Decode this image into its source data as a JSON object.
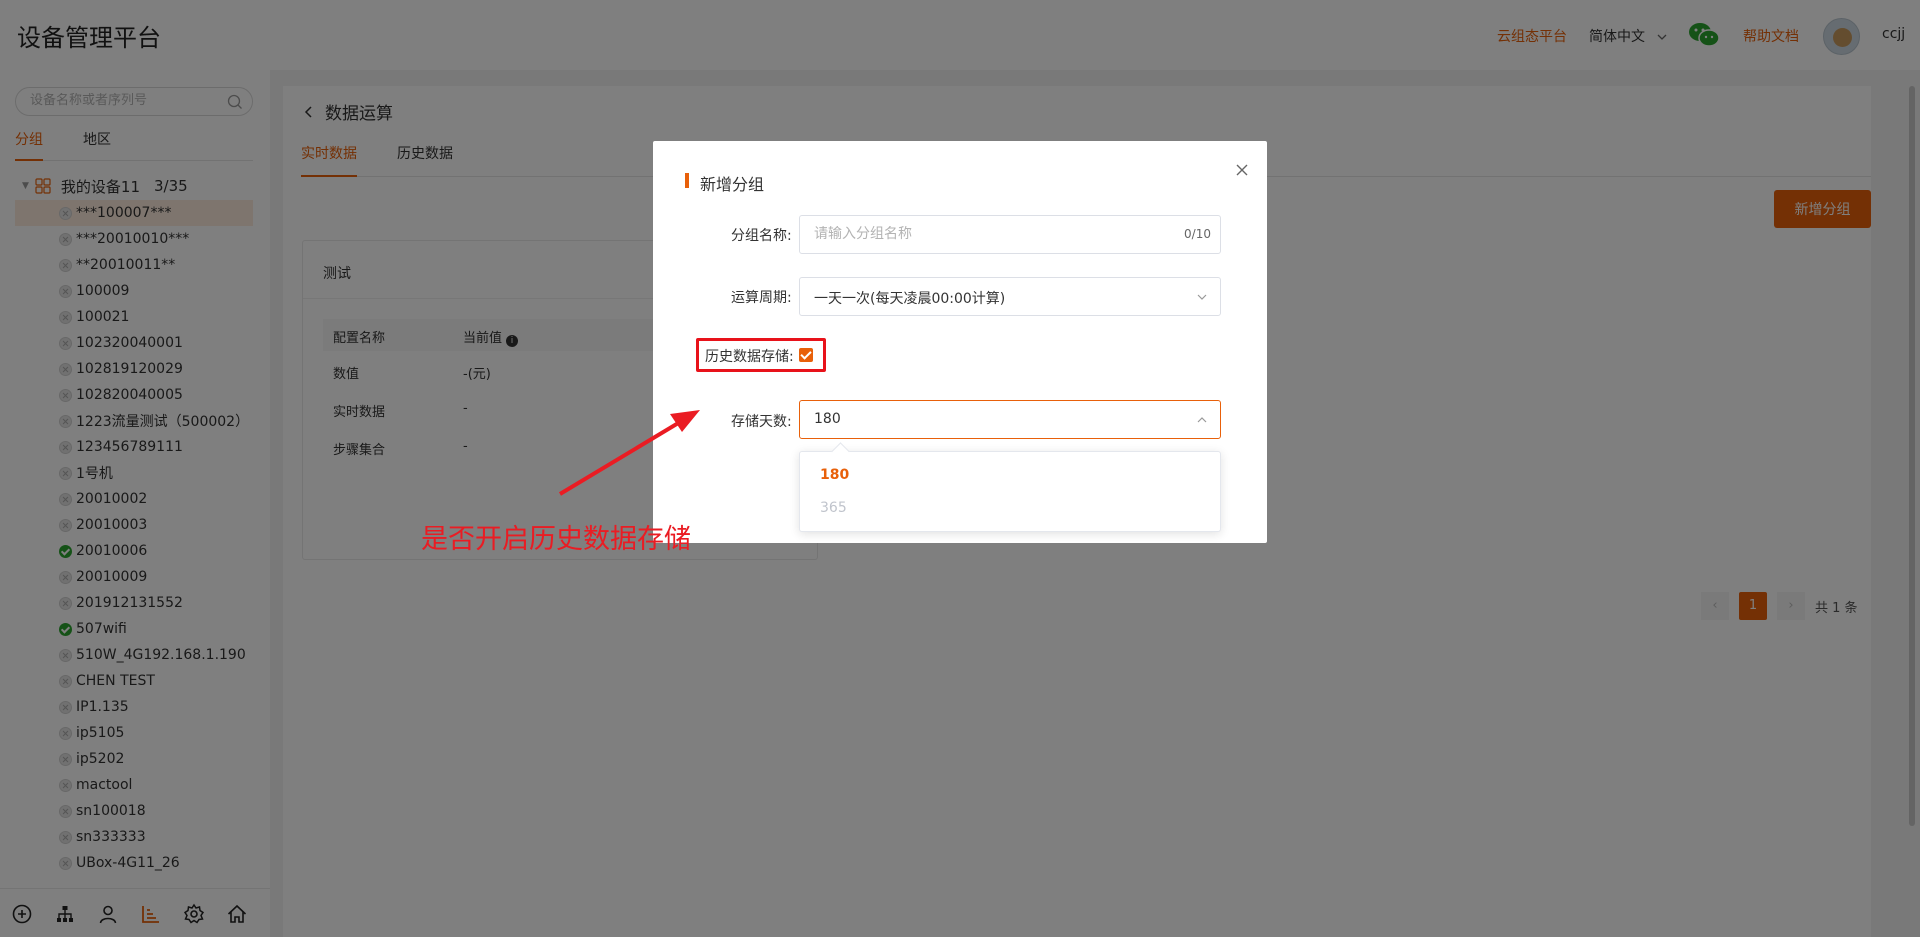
{
  "header": {
    "title": "设备管理平台",
    "links": {
      "cloud_platform": "云组态平台",
      "language": "简体中文",
      "help": "帮助文档"
    },
    "username": "ccjj",
    "icons": [
      "wechat-icon",
      "chevron-down-icon",
      "avatar"
    ]
  },
  "sidebar": {
    "search_placeholder": "设备名称或者序列号",
    "tabs": [
      "分组",
      "地区"
    ],
    "active_tab": "分组",
    "root": {
      "label": "我的设备11",
      "count": "3/35"
    },
    "devices": [
      {
        "name": "***100007***",
        "status": "offline"
      },
      {
        "name": "***20010010***",
        "status": "offline"
      },
      {
        "name": "**20010011**",
        "status": "offline"
      },
      {
        "name": "100009",
        "status": "offline"
      },
      {
        "name": "100021",
        "status": "offline"
      },
      {
        "name": "102320040001",
        "status": "offline"
      },
      {
        "name": "102819120029",
        "status": "offline"
      },
      {
        "name": "102820040005",
        "status": "offline"
      },
      {
        "name": "1223流量测试（500002）",
        "status": "offline"
      },
      {
        "name": "123456789111",
        "status": "offline"
      },
      {
        "name": "1号机",
        "status": "offline"
      },
      {
        "name": "20010002",
        "status": "offline"
      },
      {
        "name": "20010003",
        "status": "offline"
      },
      {
        "name": "20010006",
        "status": "online"
      },
      {
        "name": "20010009",
        "status": "offline"
      },
      {
        "name": "201912131552",
        "status": "offline"
      },
      {
        "name": "507wifi",
        "status": "online"
      },
      {
        "name": "510W_4G192.168.1.190",
        "status": "offline"
      },
      {
        "name": "CHEN TEST",
        "status": "offline"
      },
      {
        "name": "IP1.135",
        "status": "offline"
      },
      {
        "name": "ip5105",
        "status": "offline"
      },
      {
        "name": "ip5202",
        "status": "offline"
      },
      {
        "name": "mactool",
        "status": "offline"
      },
      {
        "name": "sn100018",
        "status": "offline"
      },
      {
        "name": "sn333333",
        "status": "offline"
      },
      {
        "name": "UBox-4G11_26",
        "status": "offline"
      }
    ],
    "bottom_icons": [
      "add-circle-icon",
      "org-tree-icon",
      "user-icon",
      "data-calc-icon",
      "settings-icon",
      "home-icon"
    ]
  },
  "main": {
    "page_title": "数据运算",
    "tabs": [
      "实时数据",
      "历史数据"
    ],
    "active_tab": "实时数据",
    "add_button": "新增分组",
    "card": {
      "title": "测试",
      "columns": [
        "配置名称",
        "当前值"
      ],
      "rows": [
        [
          "数值",
          "-(元)"
        ],
        [
          "实时数据",
          "-"
        ],
        [
          "步骤集合",
          "-"
        ]
      ]
    },
    "pagination": {
      "prev": "‹",
      "current": "1",
      "next": "›",
      "total": "共 1 条"
    }
  },
  "modal": {
    "title": "新增分组",
    "fields": {
      "name_label": "分组名称:",
      "name_placeholder": "请输入分组名称",
      "name_count": "0/10",
      "period_label": "运算周期:",
      "period_value": "一天一次(每天凌晨00:00计算)",
      "history_label": "历史数据存储:",
      "history_checked": true,
      "days_label": "存储天数:",
      "days_value": "180"
    },
    "days_options": [
      "180",
      "365"
    ],
    "selected_option": "180"
  },
  "annotation": {
    "text": "是否开启历史数据存储",
    "color": "#ea1c23"
  },
  "colors": {
    "accent": "#e8600a",
    "online": "#2aa52e",
    "highlight": "#e8121a"
  }
}
